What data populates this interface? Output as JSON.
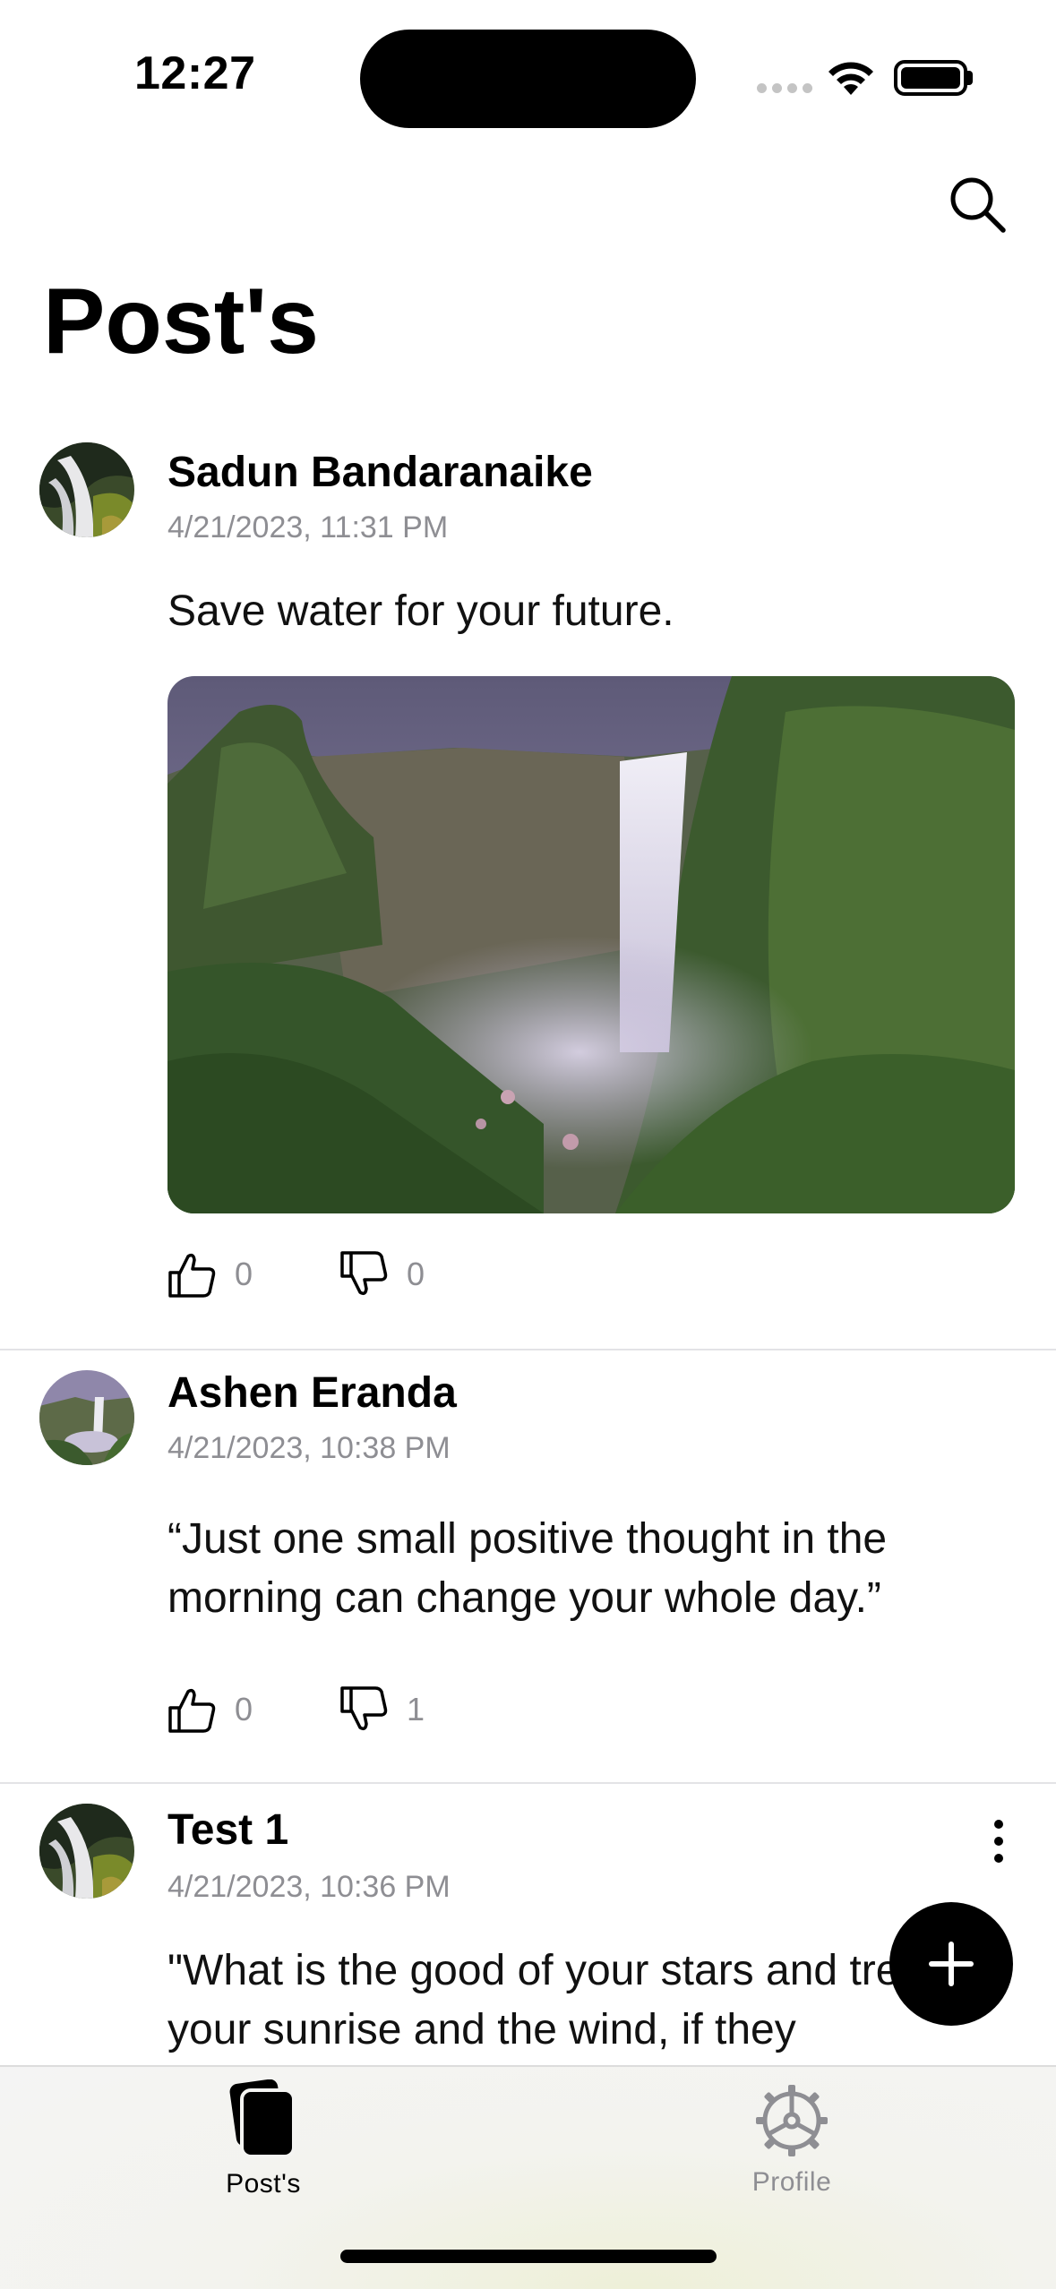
{
  "status_bar": {
    "time": "12:27"
  },
  "header": {
    "title": "Post's",
    "search_icon": "search-icon"
  },
  "posts": [
    {
      "author": "Sadun Bandaranaike",
      "timestamp": "4/21/2023, 11:31 PM",
      "text": "Save water for your future.",
      "has_image": true,
      "likes": "0",
      "dislikes": "0"
    },
    {
      "author": "Ashen Eranda",
      "timestamp": "4/21/2023, 10:38 PM",
      "text": "“Just one small positive thought in the morning can change your whole day.”",
      "likes": "0",
      "dislikes": "1"
    },
    {
      "author": "Test 1",
      "timestamp": "4/21/2023, 10:36 PM",
      "text": "\"What is the good of your stars and trees, your sunrise and the wind, if they",
      "has_more_menu": true
    }
  ],
  "fab": {
    "icon": "plus-icon"
  },
  "tab_bar": {
    "tabs": [
      {
        "label": "Post's",
        "icon": "posts-icon",
        "active": true
      },
      {
        "label": "Profile",
        "icon": "gear-icon",
        "active": false
      }
    ]
  },
  "colors": {
    "accent": "#000000",
    "inactive": "#8e8e93",
    "secondary_text": "#8e8e93"
  }
}
